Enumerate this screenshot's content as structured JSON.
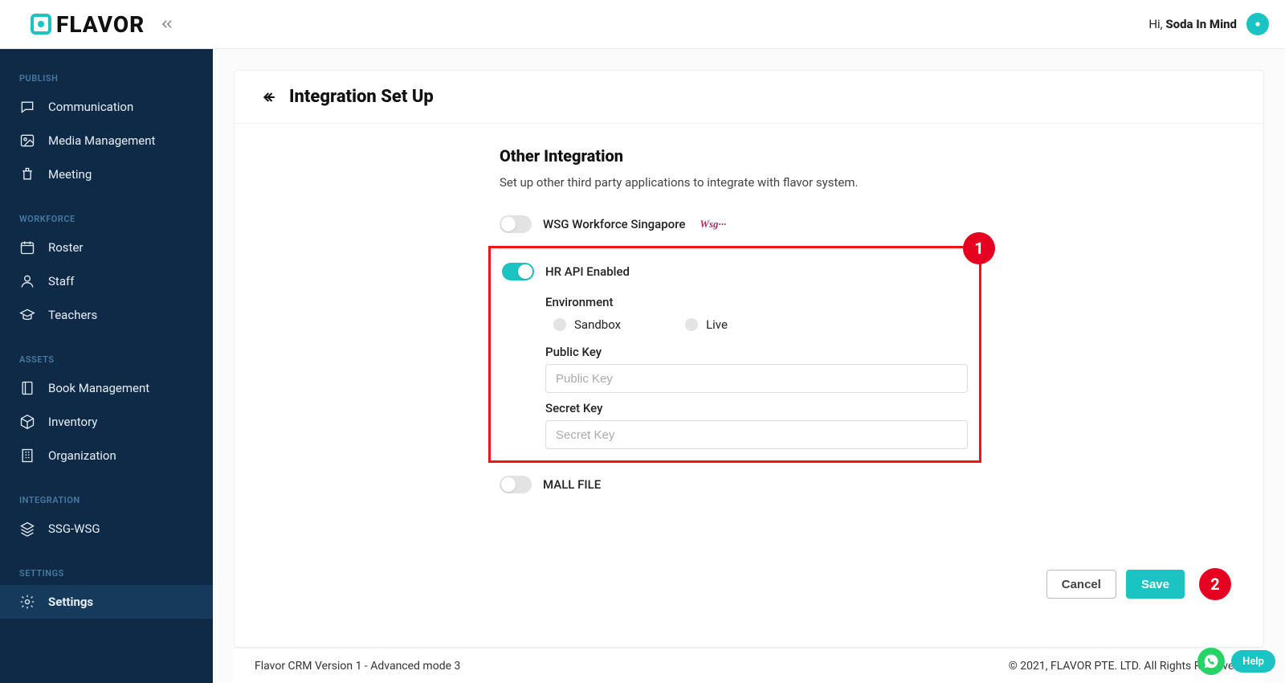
{
  "header": {
    "brand": "FLAVOR",
    "greeting_prefix": "Hi, ",
    "user_name": "Soda In Mind"
  },
  "sidebar": {
    "sections": [
      {
        "title": "PUBLISH",
        "items": [
          {
            "id": "communication",
            "label": "Communication"
          },
          {
            "id": "media-management",
            "label": "Media Management"
          },
          {
            "id": "meeting",
            "label": "Meeting"
          }
        ]
      },
      {
        "title": "WORKFORCE",
        "items": [
          {
            "id": "roster",
            "label": "Roster"
          },
          {
            "id": "staff",
            "label": "Staff"
          },
          {
            "id": "teachers",
            "label": "Teachers"
          }
        ]
      },
      {
        "title": "ASSETS",
        "items": [
          {
            "id": "book-management",
            "label": "Book Management"
          },
          {
            "id": "inventory",
            "label": "Inventory"
          },
          {
            "id": "organization",
            "label": "Organization"
          }
        ]
      },
      {
        "title": "INTEGRATION",
        "items": [
          {
            "id": "ssg-wsg",
            "label": "SSG-WSG"
          }
        ]
      },
      {
        "title": "SETTINGS",
        "items": [
          {
            "id": "settings",
            "label": "Settings",
            "active": true
          }
        ]
      }
    ]
  },
  "page": {
    "title": "Integration Set Up",
    "section_heading": "Other Integration",
    "section_desc": "Set up other third party applications to integrate with flavor system.",
    "wsg": {
      "label": "WSG Workforce Singapore",
      "badge": "Wsg···",
      "enabled": false
    },
    "hr_api": {
      "label": "HR API Enabled",
      "enabled": true,
      "env_label": "Environment",
      "env_sandbox": "Sandbox",
      "env_live": "Live",
      "public_key_label": "Public Key",
      "public_key_placeholder": "Public Key",
      "public_key_value": "",
      "secret_key_label": "Secret Key",
      "secret_key_placeholder": "Secret Key",
      "secret_key_value": ""
    },
    "mall_file": {
      "label": "MALL FILE",
      "enabled": false
    },
    "buttons": {
      "cancel": "Cancel",
      "save": "Save"
    },
    "annotations": {
      "box": "1",
      "save": "2"
    }
  },
  "footer": {
    "left": "Flavor CRM Version 1 - Advanced mode 3",
    "right": "© 2021, FLAVOR PTE. LTD. All Rights Reserved."
  },
  "widgets": {
    "help": "Help"
  }
}
